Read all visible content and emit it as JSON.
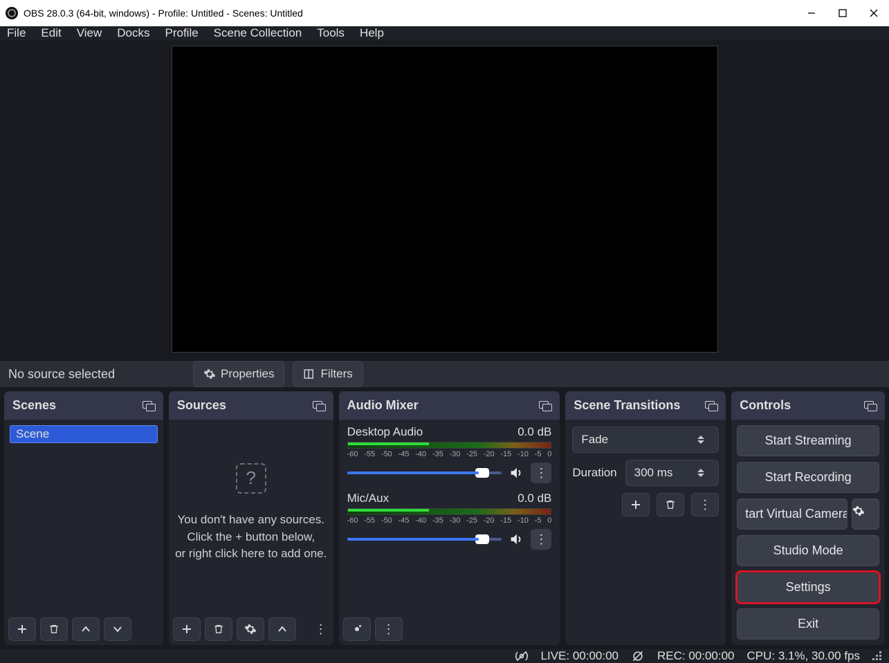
{
  "titlebar": {
    "text": "OBS 28.0.3 (64-bit, windows) - Profile: Untitled - Scenes: Untitled"
  },
  "menu": {
    "items": [
      "File",
      "Edit",
      "View",
      "Docks",
      "Profile",
      "Scene Collection",
      "Tools",
      "Help"
    ]
  },
  "sourcebar": {
    "no_source": "No source selected",
    "properties": "Properties",
    "filters": "Filters"
  },
  "scenes": {
    "title": "Scenes",
    "items": [
      "Scene"
    ]
  },
  "sources": {
    "title": "Sources",
    "empty1": "You don't have any sources.",
    "empty2": "Click the + button below,",
    "empty3": "or right click here to add one."
  },
  "mixer": {
    "title": "Audio Mixer",
    "ticks": [
      "-60",
      "-55",
      "-50",
      "-45",
      "-40",
      "-35",
      "-30",
      "-25",
      "-20",
      "-15",
      "-10",
      "-5",
      "0"
    ],
    "channels": [
      {
        "name": "Desktop Audio",
        "db": "0.0 dB"
      },
      {
        "name": "Mic/Aux",
        "db": "0.0 dB"
      }
    ]
  },
  "transitions": {
    "title": "Scene Transitions",
    "selected": "Fade",
    "duration_label": "Duration",
    "duration_value": "300 ms"
  },
  "controls": {
    "title": "Controls",
    "start_streaming": "Start Streaming",
    "start_recording": "Start Recording",
    "start_vcam": "tart Virtual Camera",
    "studio_mode": "Studio Mode",
    "settings": "Settings",
    "exit": "Exit"
  },
  "status": {
    "live": "LIVE: 00:00:00",
    "rec": "REC: 00:00:00",
    "cpu": "CPU: 3.1%, 30.00 fps"
  }
}
